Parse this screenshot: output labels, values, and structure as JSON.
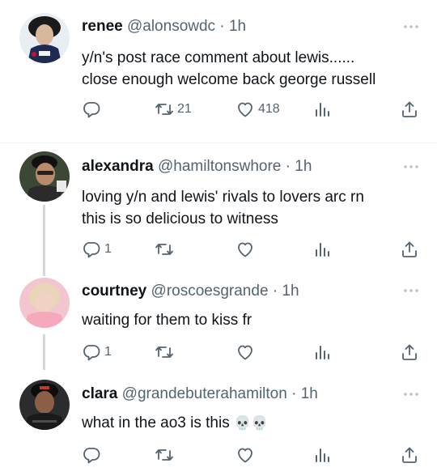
{
  "tweets": [
    {
      "name": "renee",
      "handle": "@alonsowdc",
      "dot": "·",
      "time": "1h",
      "lines": [
        "y/n's post race comment about lewis......",
        "close enough welcome back george russell"
      ],
      "reply_count": "",
      "retweet_count": "21",
      "like_count": "418"
    },
    {
      "name": "alexandra",
      "handle": "@hamiltonswhore",
      "dot": "·",
      "time": "1h",
      "lines": [
        "loving y/n and lewis' rivals to lovers arc rn",
        "this is so delicious to witness"
      ],
      "reply_count": "1",
      "retweet_count": "",
      "like_count": ""
    },
    {
      "name": "courtney",
      "handle": "@roscoesgrande",
      "dot": "·",
      "time": "1h",
      "lines": [
        "waiting for them to kiss fr"
      ],
      "reply_count": "1",
      "retweet_count": "",
      "like_count": ""
    },
    {
      "name": "clara",
      "handle": "@grandebuterahamilton",
      "dot": "·",
      "time": "1h",
      "lines": [
        "what in the ao3 is this"
      ],
      "emoji": "💀💀",
      "reply_count": "",
      "retweet_count": "",
      "like_count": ""
    }
  ],
  "colors": {
    "text": "#0f1419",
    "secondary": "#536471",
    "divider": "#eff3f4",
    "thread": "#cfd9de"
  }
}
